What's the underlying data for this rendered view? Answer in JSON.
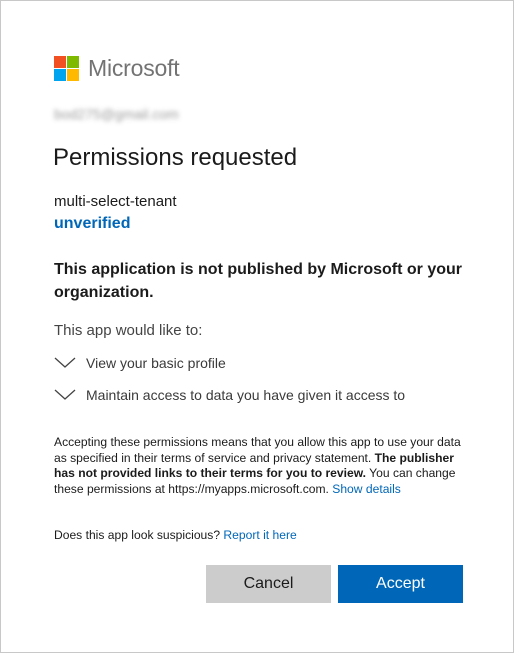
{
  "brand": {
    "name": "Microsoft",
    "logo_colors": [
      "#f25022",
      "#7fba00",
      "#00a4ef",
      "#ffb900"
    ]
  },
  "account": {
    "email": "bod275@gmail.com"
  },
  "dialog": {
    "title": "Permissions requested",
    "app_name": "multi-select-tenant",
    "verification_status": "unverified",
    "warning": "This application is not published by Microsoft or your organization.",
    "intro": "This app would like to:",
    "permissions": [
      {
        "label": "View your basic profile",
        "icon": "chevron-down-icon"
      },
      {
        "label": "Maintain access to data you have given it access to",
        "icon": "chevron-down-icon"
      }
    ],
    "fineprint": {
      "part1": "Accepting these permissions means that you allow this app to use your data as specified in their terms of service and privacy statement. ",
      "bold": "The publisher has not provided links to their terms for you to review.",
      "part2": " You can change these permissions at https://myapps.microsoft.com. ",
      "show_details": "Show details"
    },
    "suspicious": {
      "question": "Does this app look suspicious? ",
      "report_link": "Report it here"
    }
  },
  "buttons": {
    "cancel": "Cancel",
    "accept": "Accept"
  },
  "colors": {
    "accent": "#0067b8",
    "cancel_bg": "#cccccc",
    "text": "#1b1b1b"
  }
}
